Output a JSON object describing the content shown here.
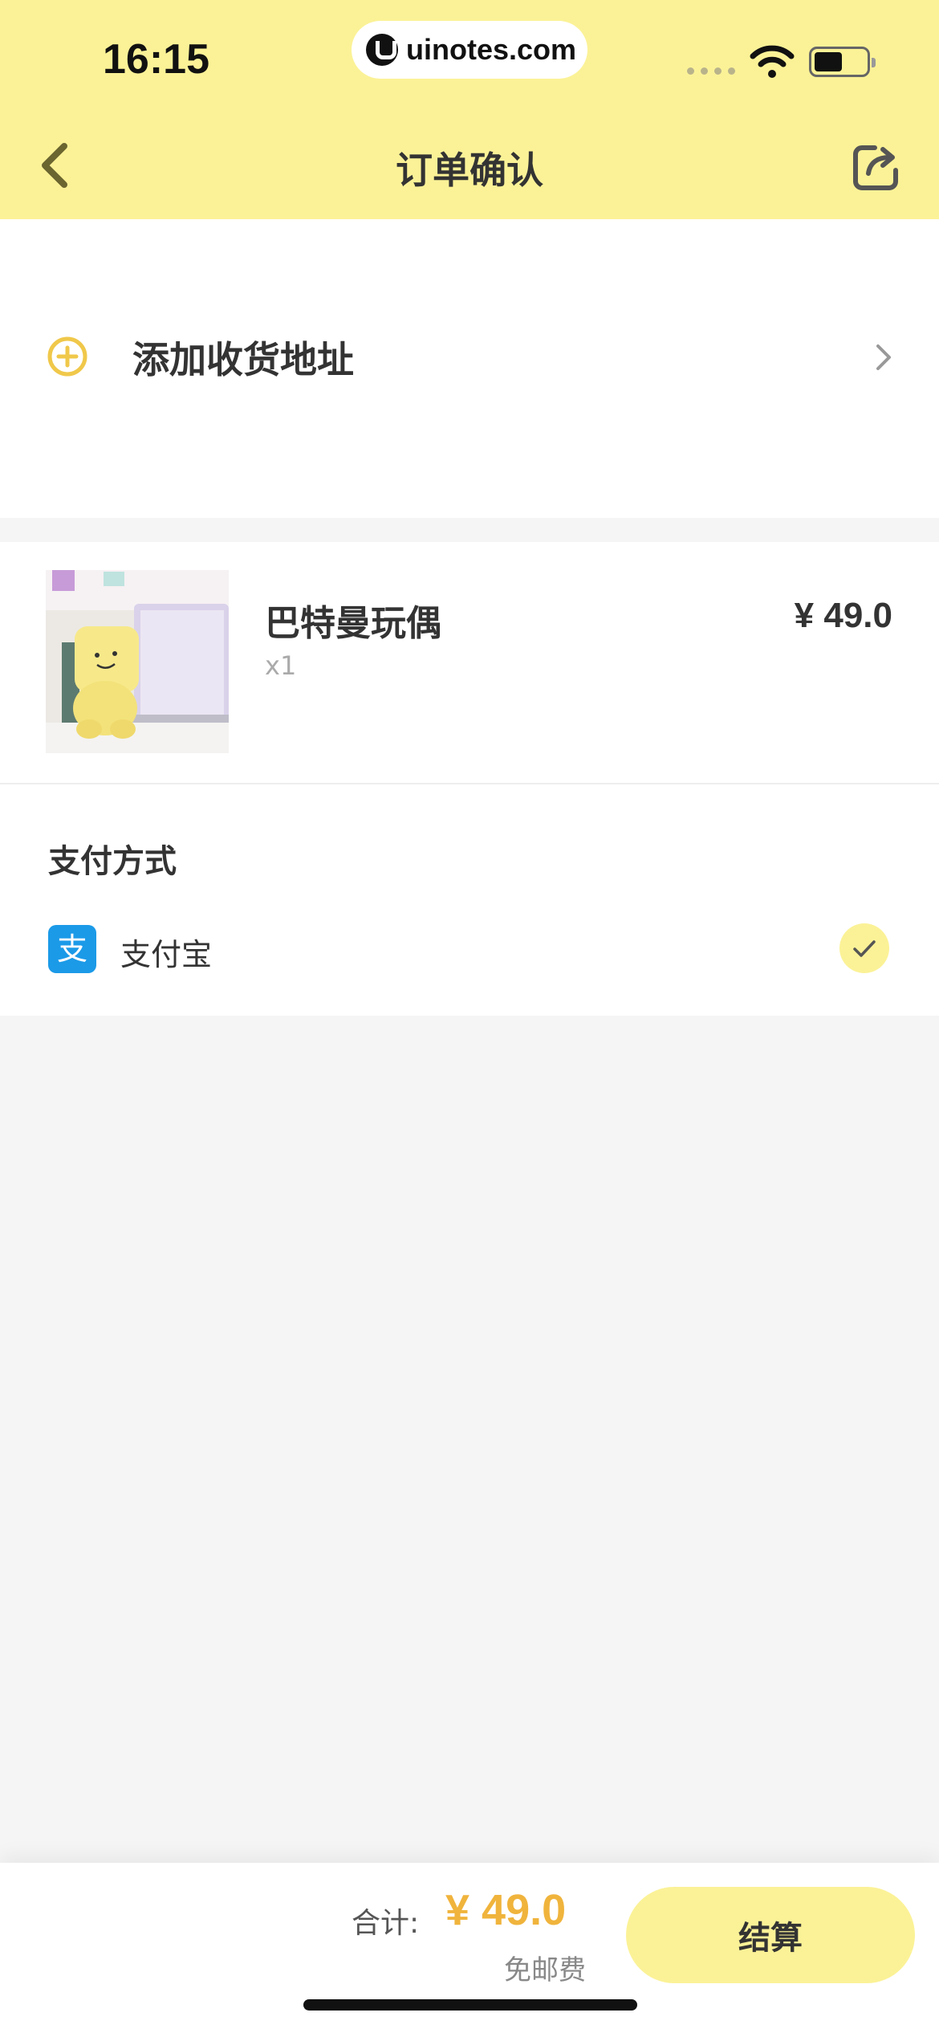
{
  "status_bar": {
    "time": "16:15",
    "url": "uinotes.com"
  },
  "nav": {
    "title": "订单确认"
  },
  "address": {
    "add_label": "添加收货地址"
  },
  "product": {
    "name": "巴特曼玩偶",
    "quantity": "x1",
    "price": "¥ 49.0"
  },
  "payment": {
    "title": "支付方式",
    "method": "支付宝",
    "method_icon_char": "支",
    "selected": true
  },
  "footer": {
    "total_label": "合计:",
    "total_price": "¥ 49.0",
    "shipping_note": "免邮费",
    "checkout_label": "结算"
  },
  "colors": {
    "brand_yellow": "#fbf297",
    "price_orange": "#f0b43c",
    "alipay_blue": "#1b9ae8"
  },
  "icons": [
    "back-arrow-icon",
    "share-icon",
    "add-circle-icon",
    "chevron-right-icon",
    "alipay-icon",
    "check-icon",
    "wifi-icon",
    "battery-icon"
  ]
}
